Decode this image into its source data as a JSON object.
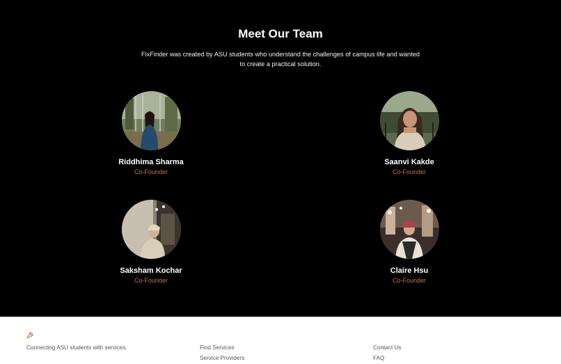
{
  "team": {
    "title": "Meet Our Team",
    "description": "FixFinder was created by ASU students who understand the challenges of campus life and wanted to create a practical solution.",
    "members": [
      {
        "name": "Riddhima Sharma",
        "role": "Co-Founder"
      },
      {
        "name": "Saanvi Kakde",
        "role": "Co-Founder"
      },
      {
        "name": "Saksham Kochar",
        "role": "Co-Founder"
      },
      {
        "name": "Claire Hsu",
        "role": "Co-Founder"
      }
    ]
  },
  "footer": {
    "logo_icon": "wrench-icon",
    "tagline": "Connecting ASU students with services.",
    "links_col1": [
      "Find Services",
      "Service Providers"
    ],
    "links_col2": [
      "Contact Us",
      "FAQ"
    ]
  },
  "colors": {
    "accent": "#c8733f",
    "background": "#000000",
    "footer_bg": "#ffffff"
  }
}
